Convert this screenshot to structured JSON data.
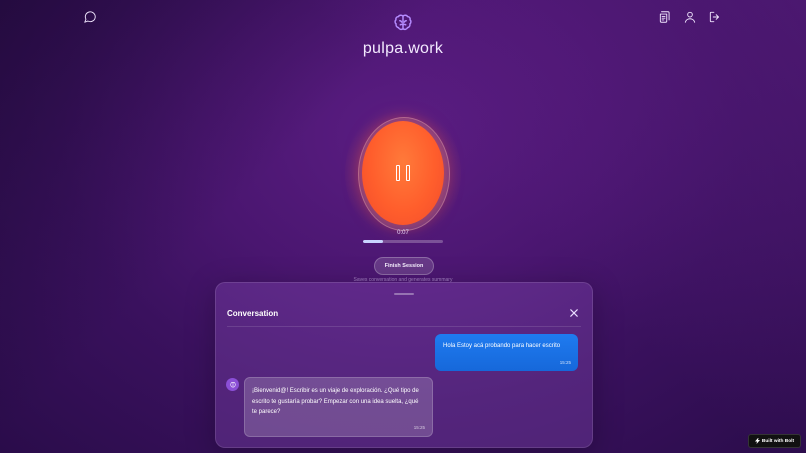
{
  "app": {
    "brand": "pulpa.work"
  },
  "header": {
    "left_icon": "chat-bubble-icon",
    "right_icons": [
      "history-icon",
      "user-icon",
      "logout-icon"
    ],
    "logo_icon": "brain-icon"
  },
  "recorder": {
    "state_icon": "pause-icon",
    "timer": "0:07",
    "progress": 0.25
  },
  "session": {
    "finish_label": "Finish Session",
    "finish_hint": "Saves conversation and generates summary"
  },
  "conversation": {
    "title": "Conversation",
    "messages": [
      {
        "role": "user",
        "text": "Hola Estoy acá probando para hacer escrito",
        "time": "15:25"
      },
      {
        "role": "assistant",
        "text": "¡Bienvenid@! Escribir es un viaje de exploración. ¿Qué tipo de escrito te gustaría probar? Empezar con una idea suelta, ¿qué te parece?",
        "time": "15:25"
      }
    ]
  },
  "badge": {
    "label": "Built with Bolt"
  },
  "colors": {
    "orb": "#ff5e2c",
    "user_bubble": "#1f7bf0",
    "accent": "#b58cff"
  }
}
